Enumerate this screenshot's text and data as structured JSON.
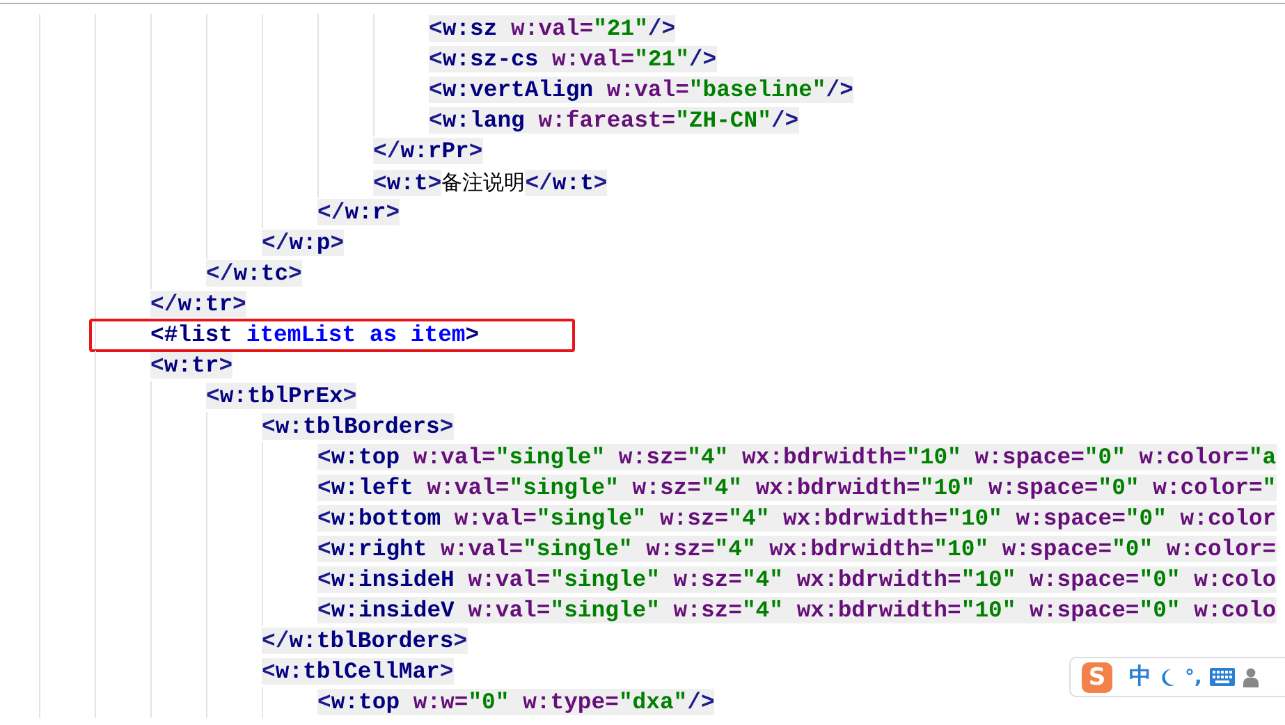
{
  "editor": {
    "lines": [
      {
        "children": [
          {
            "children": [
              {
                "children": [
                  {
                    "children": [
                      {
                        "children": [
                          {
                            "boxed": false,
                            "tokens": [
                              {
                                "kind": "punct",
                                "text": "<"
                              },
                              {
                                "kind": "name",
                                "text": "w:sz"
                              },
                              {
                                "kind": "attr",
                                "text": " w:val="
                              },
                              {
                                "kind": "value",
                                "text": "\"21\""
                              },
                              {
                                "kind": "punct",
                                "text": "/>"
                              }
                            ]
                          },
                          {
                            "boxed": false,
                            "tokens": [
                              {
                                "kind": "punct",
                                "text": "<"
                              },
                              {
                                "kind": "name",
                                "text": "w:sz-cs"
                              },
                              {
                                "kind": "attr",
                                "text": " w:val="
                              },
                              {
                                "kind": "value",
                                "text": "\"21\""
                              },
                              {
                                "kind": "punct",
                                "text": "/>"
                              }
                            ]
                          },
                          {
                            "boxed": false,
                            "tokens": [
                              {
                                "kind": "punct",
                                "text": "<"
                              },
                              {
                                "kind": "name",
                                "text": "w:vertAlign"
                              },
                              {
                                "kind": "attr",
                                "text": " w:val="
                              },
                              {
                                "kind": "value",
                                "text": "\"baseline\""
                              },
                              {
                                "kind": "punct",
                                "text": "/>"
                              }
                            ]
                          },
                          {
                            "boxed": false,
                            "tokens": [
                              {
                                "kind": "punct",
                                "text": "<"
                              },
                              {
                                "kind": "name",
                                "text": "w:lang"
                              },
                              {
                                "kind": "attr",
                                "text": " w:fareast="
                              },
                              {
                                "kind": "value",
                                "text": "\"ZH-CN\""
                              },
                              {
                                "kind": "punct",
                                "text": "/>"
                              }
                            ]
                          }
                        ]
                      },
                      {
                        "boxed": false,
                        "tokens": [
                          {
                            "kind": "punct",
                            "text": "</"
                          },
                          {
                            "kind": "name",
                            "text": "w:rPr"
                          },
                          {
                            "kind": "punct",
                            "text": ">"
                          }
                        ]
                      },
                      {
                        "boxed": false,
                        "tokens": [
                          {
                            "kind": "punct",
                            "text": "<"
                          },
                          {
                            "kind": "name",
                            "text": "w:t"
                          },
                          {
                            "kind": "punct",
                            "text": ">"
                          },
                          {
                            "kind": "text",
                            "text": "备注说明"
                          },
                          {
                            "kind": "punct",
                            "text": "</"
                          },
                          {
                            "kind": "name",
                            "text": "w:t"
                          },
                          {
                            "kind": "punct",
                            "text": ">"
                          }
                        ]
                      }
                    ]
                  },
                  {
                    "boxed": false,
                    "tokens": [
                      {
                        "kind": "punct",
                        "text": "</"
                      },
                      {
                        "kind": "name",
                        "text": "w:r"
                      },
                      {
                        "kind": "punct",
                        "text": ">"
                      }
                    ]
                  }
                ]
              },
              {
                "boxed": false,
                "tokens": [
                  {
                    "kind": "punct",
                    "text": "</"
                  },
                  {
                    "kind": "name",
                    "text": "w:p"
                  },
                  {
                    "kind": "punct",
                    "text": ">"
                  }
                ]
              }
            ]
          },
          {
            "boxed": false,
            "tokens": [
              {
                "kind": "punct",
                "text": "</"
              },
              {
                "kind": "name",
                "text": "w:tc"
              },
              {
                "kind": "punct",
                "text": ">"
              }
            ]
          }
        ]
      },
      {
        "boxed": false,
        "tokens": [
          {
            "kind": "punct",
            "text": "</"
          },
          {
            "kind": "name",
            "text": "w:tr"
          },
          {
            "kind": "punct",
            "text": ">"
          }
        ]
      },
      {
        "boxed": true,
        "tokens": [
          {
            "kind": "directive",
            "text": "<#list"
          },
          {
            "kind": "ident",
            "text": " itemList as item"
          },
          {
            "kind": "directive",
            "text": ">"
          }
        ]
      },
      {
        "boxed": false,
        "tokens": [
          {
            "kind": "punct",
            "text": "<"
          },
          {
            "kind": "name",
            "text": "w:tr"
          },
          {
            "kind": "punct",
            "text": ">"
          }
        ]
      },
      {
        "children": [
          {
            "boxed": false,
            "tokens": [
              {
                "kind": "punct",
                "text": "<"
              },
              {
                "kind": "name",
                "text": "w:tblPrEx"
              },
              {
                "kind": "punct",
                "text": ">"
              }
            ]
          },
          {
            "children": [
              {
                "boxed": false,
                "tokens": [
                  {
                    "kind": "punct",
                    "text": "<"
                  },
                  {
                    "kind": "name",
                    "text": "w:tblBorders"
                  },
                  {
                    "kind": "punct",
                    "text": ">"
                  }
                ]
              },
              {
                "children": [
                  {
                    "boxed": false,
                    "tokens": [
                      {
                        "kind": "punct",
                        "text": "<"
                      },
                      {
                        "kind": "name",
                        "text": "w:top"
                      },
                      {
                        "kind": "attr",
                        "text": " w:val="
                      },
                      {
                        "kind": "value",
                        "text": "\"single\""
                      },
                      {
                        "kind": "attr",
                        "text": " w:sz="
                      },
                      {
                        "kind": "value",
                        "text": "\"4\""
                      },
                      {
                        "kind": "attr",
                        "text": " wx:bdrwidth="
                      },
                      {
                        "kind": "value",
                        "text": "\"10\""
                      },
                      {
                        "kind": "attr",
                        "text": " w:space="
                      },
                      {
                        "kind": "value",
                        "text": "\"0\""
                      },
                      {
                        "kind": "attr",
                        "text": " w:color="
                      },
                      {
                        "kind": "value",
                        "text": "\"a"
                      }
                    ]
                  },
                  {
                    "boxed": false,
                    "tokens": [
                      {
                        "kind": "punct",
                        "text": "<"
                      },
                      {
                        "kind": "name",
                        "text": "w:left"
                      },
                      {
                        "kind": "attr",
                        "text": " w:val="
                      },
                      {
                        "kind": "value",
                        "text": "\"single\""
                      },
                      {
                        "kind": "attr",
                        "text": " w:sz="
                      },
                      {
                        "kind": "value",
                        "text": "\"4\""
                      },
                      {
                        "kind": "attr",
                        "text": " wx:bdrwidth="
                      },
                      {
                        "kind": "value",
                        "text": "\"10\""
                      },
                      {
                        "kind": "attr",
                        "text": " w:space="
                      },
                      {
                        "kind": "value",
                        "text": "\"0\""
                      },
                      {
                        "kind": "attr",
                        "text": " w:color="
                      },
                      {
                        "kind": "value",
                        "text": "\""
                      }
                    ]
                  },
                  {
                    "boxed": false,
                    "tokens": [
                      {
                        "kind": "punct",
                        "text": "<"
                      },
                      {
                        "kind": "name",
                        "text": "w:bottom"
                      },
                      {
                        "kind": "attr",
                        "text": " w:val="
                      },
                      {
                        "kind": "value",
                        "text": "\"single\""
                      },
                      {
                        "kind": "attr",
                        "text": " w:sz="
                      },
                      {
                        "kind": "value",
                        "text": "\"4\""
                      },
                      {
                        "kind": "attr",
                        "text": " wx:bdrwidth="
                      },
                      {
                        "kind": "value",
                        "text": "\"10\""
                      },
                      {
                        "kind": "attr",
                        "text": " w:space="
                      },
                      {
                        "kind": "value",
                        "text": "\"0\""
                      },
                      {
                        "kind": "attr",
                        "text": " w:color"
                      }
                    ]
                  },
                  {
                    "boxed": false,
                    "tokens": [
                      {
                        "kind": "punct",
                        "text": "<"
                      },
                      {
                        "kind": "name",
                        "text": "w:right"
                      },
                      {
                        "kind": "attr",
                        "text": " w:val="
                      },
                      {
                        "kind": "value",
                        "text": "\"single\""
                      },
                      {
                        "kind": "attr",
                        "text": " w:sz="
                      },
                      {
                        "kind": "value",
                        "text": "\"4\""
                      },
                      {
                        "kind": "attr",
                        "text": " wx:bdrwidth="
                      },
                      {
                        "kind": "value",
                        "text": "\"10\""
                      },
                      {
                        "kind": "attr",
                        "text": " w:space="
                      },
                      {
                        "kind": "value",
                        "text": "\"0\""
                      },
                      {
                        "kind": "attr",
                        "text": " w:color="
                      }
                    ]
                  },
                  {
                    "boxed": false,
                    "tokens": [
                      {
                        "kind": "punct",
                        "text": "<"
                      },
                      {
                        "kind": "name",
                        "text": "w:insideH"
                      },
                      {
                        "kind": "attr",
                        "text": " w:val="
                      },
                      {
                        "kind": "value",
                        "text": "\"single\""
                      },
                      {
                        "kind": "attr",
                        "text": " w:sz="
                      },
                      {
                        "kind": "value",
                        "text": "\"4\""
                      },
                      {
                        "kind": "attr",
                        "text": " wx:bdrwidth="
                      },
                      {
                        "kind": "value",
                        "text": "\"10\""
                      },
                      {
                        "kind": "attr",
                        "text": " w:space="
                      },
                      {
                        "kind": "value",
                        "text": "\"0\""
                      },
                      {
                        "kind": "attr",
                        "text": " w:colo"
                      }
                    ]
                  },
                  {
                    "boxed": false,
                    "tokens": [
                      {
                        "kind": "punct",
                        "text": "<"
                      },
                      {
                        "kind": "name",
                        "text": "w:insideV"
                      },
                      {
                        "kind": "attr",
                        "text": " w:val="
                      },
                      {
                        "kind": "value",
                        "text": "\"single\""
                      },
                      {
                        "kind": "attr",
                        "text": " w:sz="
                      },
                      {
                        "kind": "value",
                        "text": "\"4\""
                      },
                      {
                        "kind": "attr",
                        "text": " wx:bdrwidth="
                      },
                      {
                        "kind": "value",
                        "text": "\"10\""
                      },
                      {
                        "kind": "attr",
                        "text": " w:space="
                      },
                      {
                        "kind": "value",
                        "text": "\"0\""
                      },
                      {
                        "kind": "attr",
                        "text": " w:colo"
                      }
                    ]
                  }
                ]
              },
              {
                "boxed": false,
                "tokens": [
                  {
                    "kind": "punct",
                    "text": "</"
                  },
                  {
                    "kind": "name",
                    "text": "w:tblBorders"
                  },
                  {
                    "kind": "punct",
                    "text": ">"
                  }
                ]
              },
              {
                "boxed": false,
                "tokens": [
                  {
                    "kind": "punct",
                    "text": "<"
                  },
                  {
                    "kind": "name",
                    "text": "w:tblCellMar"
                  },
                  {
                    "kind": "punct",
                    "text": ">"
                  }
                ]
              },
              {
                "children": [
                  {
                    "boxed": false,
                    "tokens": [
                      {
                        "kind": "punct",
                        "text": "<"
                      },
                      {
                        "kind": "name",
                        "text": "w:top"
                      },
                      {
                        "kind": "attr",
                        "text": " w:w="
                      },
                      {
                        "kind": "value",
                        "text": "\"0\""
                      },
                      {
                        "kind": "attr",
                        "text": " w:type="
                      },
                      {
                        "kind": "value",
                        "text": "\"dxa\""
                      },
                      {
                        "kind": "punct",
                        "text": "/>"
                      }
                    ]
                  }
                ]
              }
            ]
          }
        ]
      }
    ]
  },
  "ime_toolbar": {
    "logo": "S",
    "mode": "中",
    "punctuation": "°,"
  }
}
